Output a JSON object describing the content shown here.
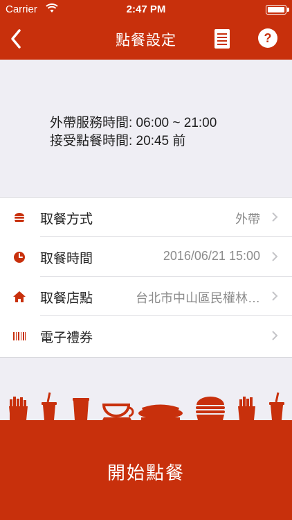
{
  "status_bar": {
    "carrier": "Carrier",
    "time": "2:47 PM"
  },
  "nav": {
    "title": "點餐設定",
    "back_icon": "chevron-left-icon",
    "doc_icon": "document-icon",
    "help_icon": "help-icon"
  },
  "info": {
    "takeout_hours": "外帶服務時間:  06:00 ~ 21:00",
    "order_accept_time": "接受點餐時間:  20:45 前"
  },
  "menu": {
    "items": [
      {
        "label": "取餐方式",
        "value": "外帶",
        "icon": "burger-icon"
      },
      {
        "label": "取餐時間",
        "value": "2016/06/21 15:00",
        "icon": "clock-icon"
      },
      {
        "label": "取餐店點",
        "value": "台北市中山區民權林…",
        "icon": "home-icon"
      },
      {
        "label": "電子禮券",
        "value": "",
        "icon": "barcode-icon"
      }
    ]
  },
  "cta": {
    "label": "開始點餐"
  },
  "colors": {
    "brand": "#c8300c",
    "panel_bg": "#efeef4"
  }
}
